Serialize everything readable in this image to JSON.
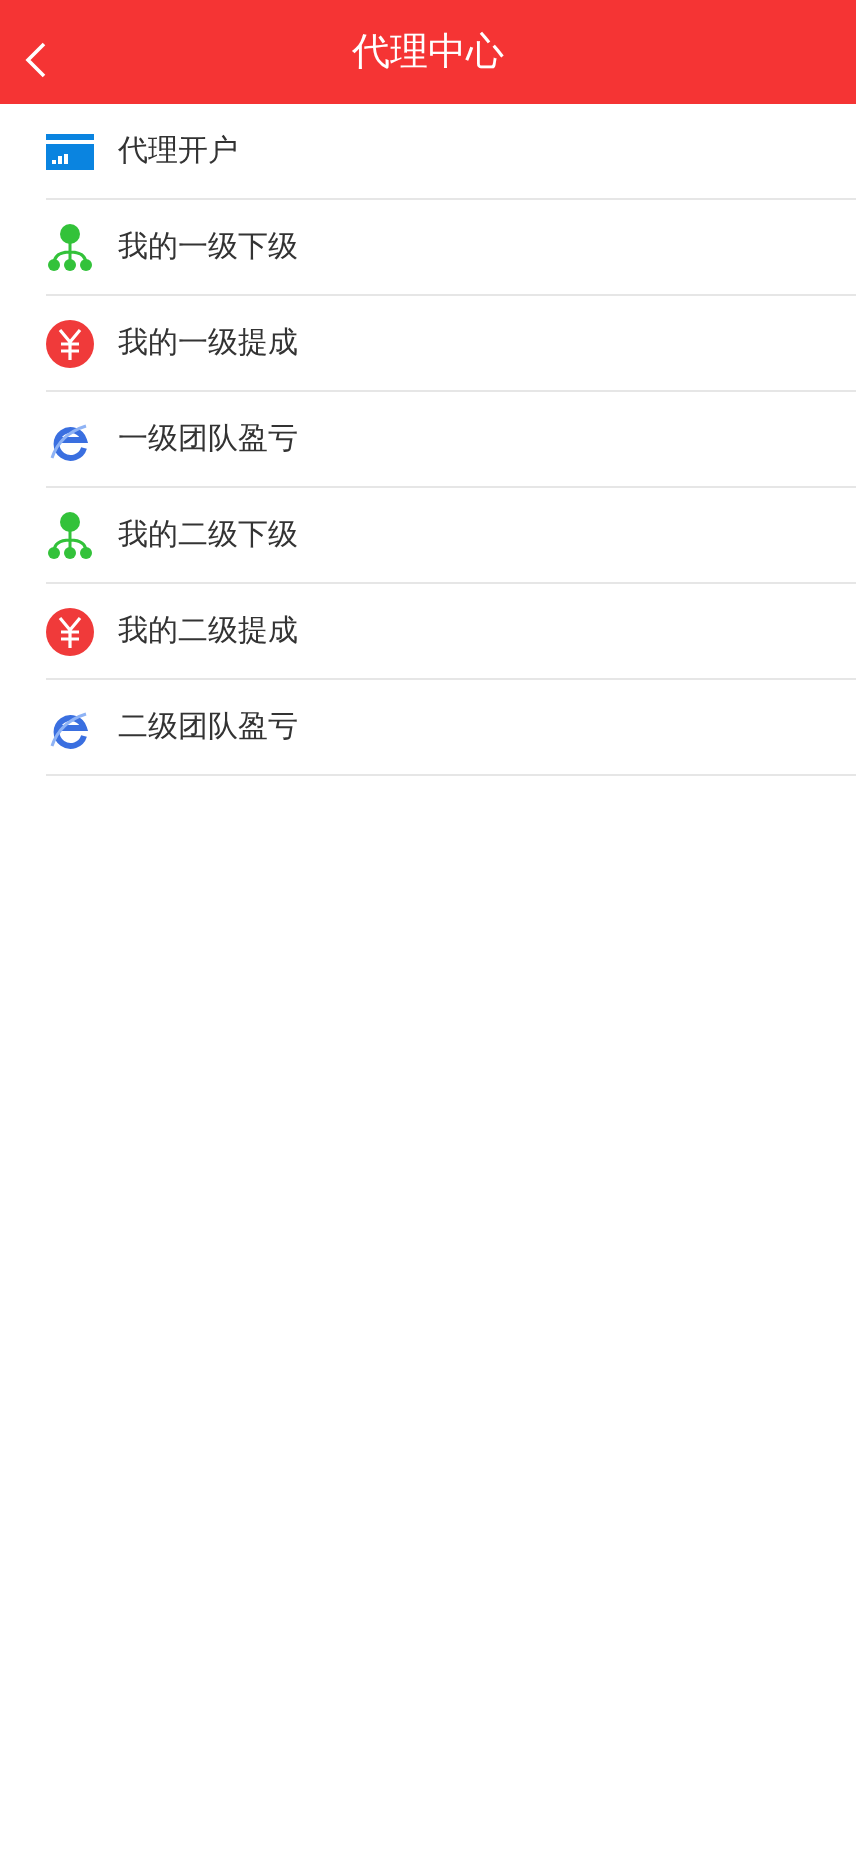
{
  "header": {
    "title": "代理中心"
  },
  "menu": [
    {
      "kind": "card",
      "label": "代理开户"
    },
    {
      "kind": "tree",
      "label": "我的一级下级"
    },
    {
      "kind": "yuan",
      "label": "我的一级提成"
    },
    {
      "kind": "swoosh",
      "label": "一级团队盈亏"
    },
    {
      "kind": "tree",
      "label": "我的二级下级"
    },
    {
      "kind": "yuan",
      "label": "我的二级提成"
    },
    {
      "kind": "swoosh",
      "label": "二级团队盈亏"
    }
  ]
}
